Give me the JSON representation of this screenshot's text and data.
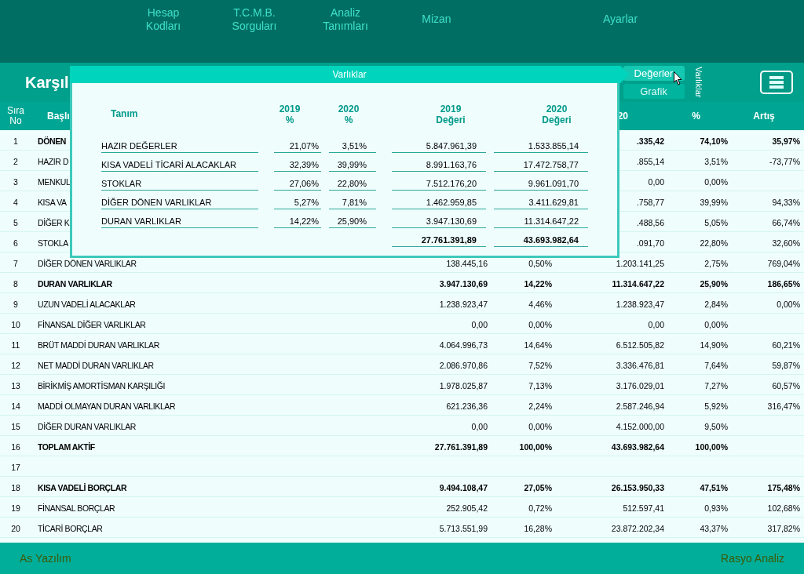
{
  "nav": [
    {
      "label": "Hesap\nKodları"
    },
    {
      "label": "T.C.M.B.\nSorguları"
    },
    {
      "label": "Analiz\nTanımları"
    },
    {
      "label": "Mizan"
    },
    {
      "label": "Ayarlar"
    }
  ],
  "title": "Karşıl",
  "view_buttons": [
    {
      "label": "Değerler",
      "selected": true
    },
    {
      "label": "Grafik",
      "selected": false
    }
  ],
  "side_label": "Varlıklar",
  "table": {
    "header": {
      "no": "Sıra\nNo",
      "name": "Başlı",
      "c5": "20",
      "c6": "%",
      "c7": "Artış"
    },
    "rows": [
      {
        "kind": "total",
        "no": "1",
        "name": "DÖNEN",
        "c5": ".335,42",
        "c6": "74,10%",
        "c7": "35,97%"
      },
      {
        "kind": "item",
        "no": "2",
        "name": "HAZIR D",
        "c5": ".855,14",
        "c6": "3,51%",
        "c7": "-73,77%"
      },
      {
        "kind": "item",
        "no": "3",
        "name": "MENKUL",
        "c5": "0,00",
        "c6": "0,00%"
      },
      {
        "kind": "item",
        "no": "4",
        "name": "KISA VA",
        "c5": ".758,77",
        "c6": "39,99%",
        "c7": "94,33%"
      },
      {
        "kind": "item",
        "no": "5",
        "name": "DİĞER K",
        "c5": ".488,56",
        "c6": "5,05%",
        "c7": "66,74%"
      },
      {
        "kind": "item",
        "no": "6",
        "name": "STOKLA",
        "c5": ".091,70",
        "c6": "22,80%",
        "c7": "32,60%"
      },
      {
        "kind": "item",
        "no": "7",
        "name": "DİĞER DÖNEN VARLIKLAR",
        "c3": "138.445,16",
        "c4": "0,50%",
        "c5": "1.203.141,25",
        "c6": "2,75%",
        "c7": "769,04%"
      },
      {
        "kind": "total",
        "no": "8",
        "name": "DURAN VARLIKLAR",
        "c3": "3.947.130,69",
        "c4": "14,22%",
        "c5": "11.314.647,22",
        "c6": "25,90%",
        "c7": "186,65%"
      },
      {
        "kind": "item",
        "no": "9",
        "name": "UZUN VADELİ ALACAKLAR",
        "c3": "1.238.923,47",
        "c4": "4,46%",
        "c5": "1.238.923,47",
        "c6": "2,84%",
        "c7": "0,00%"
      },
      {
        "kind": "item",
        "no": "10",
        "name": "FİNANSAL DİĞER VARLIKLAR",
        "c3": "0,00",
        "c4": "0,00%",
        "c5": "0,00",
        "c6": "0,00%"
      },
      {
        "kind": "item",
        "no": "11",
        "name": "BRÜT MADDİ DURAN VARLIKLAR",
        "c3": "4.064.996,73",
        "c4": "14,64%",
        "c5": "6.512.505,82",
        "c6": "14,90%",
        "c7": "60,21%"
      },
      {
        "kind": "item",
        "no": "12",
        "name": "NET MADDİ DURAN VARLIKLAR",
        "c3": "2.086.970,86",
        "c4": "7,52%",
        "c5": "3.336.476,81",
        "c6": "7,64%",
        "c7": "59,87%"
      },
      {
        "kind": "item",
        "no": "13",
        "name": "BİRİKMİŞ AMORTİSMAN KARŞILIĞI",
        "c3": "1.978.025,87",
        "c4": "7,13%",
        "c5": "3.176.029,01",
        "c6": "7,27%",
        "c7": "60,57%"
      },
      {
        "kind": "item",
        "no": "14",
        "name": "MADDİ OLMAYAN DURAN VARLIKLAR",
        "c3": "621.236,36",
        "c4": "2,24%",
        "c5": "2.587.246,94",
        "c6": "5,92%",
        "c7": "316,47%"
      },
      {
        "kind": "item",
        "no": "15",
        "name": "DİĞER DURAN VARLIKLAR",
        "c3": "0,00",
        "c4": "0,00%",
        "c5": "4.152.000,00",
        "c6": "9,50%"
      },
      {
        "kind": "total",
        "no": "16",
        "name": "TOPLAM AKTİF",
        "c3": "27.761.391,89",
        "c4": "100,00%",
        "c5": "43.693.982,64",
        "c6": "100,00%"
      },
      {
        "kind": "item",
        "no": "17"
      },
      {
        "kind": "total",
        "no": "18",
        "name": "KISA VADELİ BORÇLAR",
        "c3": "9.494.108,47",
        "c4": "27,05%",
        "c5": "26.153.950,33",
        "c6": "47,51%",
        "c7": "175,48%"
      },
      {
        "kind": "item",
        "no": "19",
        "name": "FİNANSAL BORÇLAR",
        "c3": "252.905,42",
        "c4": "0,72%",
        "c5": "512.597,41",
        "c6": "0,93%",
        "c7": "102,68%"
      },
      {
        "kind": "item",
        "no": "20",
        "name": "TİCARİ BORÇLAR",
        "c3": "5.713.551,99",
        "c4": "16,28%",
        "c5": "23.872.202,34",
        "c6": "43,37%",
        "c7": "317,82%"
      }
    ]
  },
  "popup": {
    "title": "Varlıklar",
    "columns": [
      "Tanım",
      "2019\n%",
      "2020\n%",
      "2019\nDeğeri",
      "2020\nDeğeri"
    ],
    "rows": [
      {
        "name": "HAZIR DEĞERLER",
        "p2019": "21,07%",
        "p2020": "3,51%",
        "v2019": "5.847.961,39",
        "v2020": "1.533.855,14"
      },
      {
        "name": "KISA VADELİ TİCARİ ALACAKLAR",
        "p2019": "32,39%",
        "p2020": "39,99%",
        "v2019": "8.991.163,76",
        "v2020": "17.472.758,77"
      },
      {
        "name": "STOKLAR",
        "p2019": "27,06%",
        "p2020": "22,80%",
        "v2019": "7.512.176,20",
        "v2020": "9.961.091,70"
      },
      {
        "name": "DİĞER DÖNEN VARLIKLAR",
        "p2019": "5,27%",
        "p2020": "7,81%",
        "v2019": "1.462.959,85",
        "v2020": "3.411.629,81"
      },
      {
        "name": "DURAN VARLIKLAR",
        "p2019": "14,22%",
        "p2020": "25,90%",
        "v2019": "3.947.130,69",
        "v2020": "11.314.647,22"
      }
    ],
    "totals": [
      "27.761.391,89",
      "43.693.982,64"
    ]
  },
  "footer": {
    "left": "As Yazılım",
    "right": "Rasyo Analiz"
  }
}
